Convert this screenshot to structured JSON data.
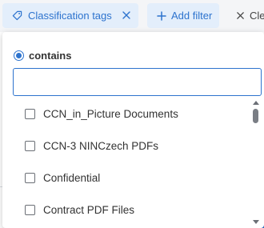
{
  "filter_bar": {
    "tags_chip_label": "Classification tags",
    "add_filter_label": "Add filter",
    "clear_label": "Cle"
  },
  "dropdown": {
    "radio_label": "contains",
    "search": {
      "value": "",
      "placeholder": ""
    },
    "items": [
      {
        "label": "CCN_in_Picture Documents",
        "checked": false
      },
      {
        "label": "CCN-3 NINCzech PDFs",
        "checked": false
      },
      {
        "label": "Confidential",
        "checked": false
      },
      {
        "label": "Contract PDF Files",
        "checked": false
      }
    ]
  },
  "icons": {
    "tag": "tag-icon",
    "close": "close-icon",
    "plus": "plus-icon",
    "clear": "x-icon",
    "radio": "radio-selected-icon"
  },
  "colors": {
    "accent": "#2d73ce",
    "chip_bg": "#e3eefb",
    "bar_bg": "#f4f5f7"
  }
}
